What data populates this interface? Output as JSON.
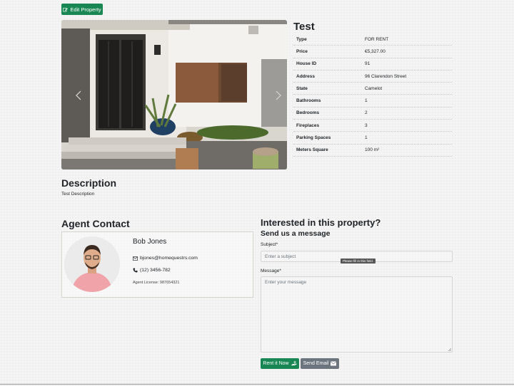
{
  "toolbar": {
    "edit_label": "Edit Property"
  },
  "carousel": {
    "prev_icon": "chevron-left-icon",
    "next_icon": "chevron-right-icon"
  },
  "property": {
    "title": "Test",
    "details": [
      {
        "label": "Type",
        "value": "FOR RENT"
      },
      {
        "label": "Price",
        "value": "€5,327.00"
      },
      {
        "label": "House ID",
        "value": "91"
      },
      {
        "label": "Address",
        "value": "96 Clarendon Street"
      },
      {
        "label": "State",
        "value": "Camelot"
      },
      {
        "label": "Bathrooms",
        "value": "1"
      },
      {
        "label": "Bedrooms",
        "value": "2"
      },
      {
        "label": "Fireplaces",
        "value": "3"
      },
      {
        "label": "Parking Spaces",
        "value": "1"
      },
      {
        "label": "Meters Square",
        "value": "100 m²"
      }
    ]
  },
  "description": {
    "heading": "Description",
    "text": "Test Description"
  },
  "agent": {
    "heading": "Agent Contact",
    "name": "Bob Jones",
    "email": "bjones@homequestrs.com",
    "phone": "(12) 3456-782",
    "license": "Agent License: 987654321"
  },
  "form": {
    "heading": "Interested in this property?",
    "subheading": "Send us a message",
    "subject_label": "Subject*",
    "subject_placeholder": "Enter a subject",
    "tooltip": "Please fill in this field.",
    "message_label": "Message*",
    "message_placeholder": "Enter your message",
    "rent_label": "Rent it Now",
    "email_label": "Send Email"
  },
  "colors": {
    "primary": "#198754",
    "secondary": "#6c757d"
  }
}
